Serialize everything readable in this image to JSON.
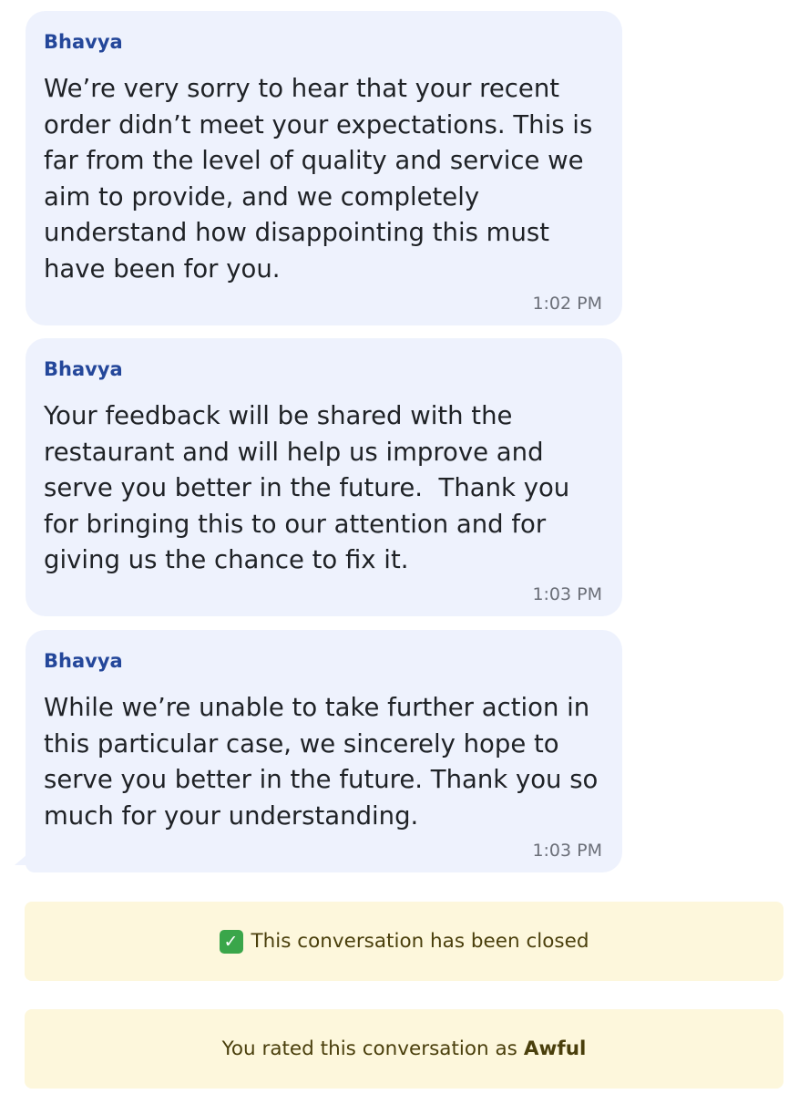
{
  "messages": [
    {
      "sender": "Bhavya",
      "text": "We’re very sorry to hear that your recent order didn’t meet your expectations. This is far from the level of quality and service we aim to provide, and we completely understand how disappointing this must have been for you.",
      "time": "1:02 PM"
    },
    {
      "sender": "Bhavya",
      "text": "Your feedback will be shared with the restaurant and will help us improve and serve you better in the future.  Thank you for bringing this to our attention and for giving us the chance to fix it.",
      "time": "1:03 PM"
    },
    {
      "sender": "Bhavya",
      "text": "While we’re unable to take further action in this particular case, we sincerely hope to serve you better in the future. Thank you so much for your understanding.",
      "time": "1:03 PM"
    }
  ],
  "notices": {
    "closed": {
      "icon": "check-mark-icon",
      "icon_glyph": "✓",
      "text": "This conversation has been closed"
    },
    "rating": {
      "prefix": "You rated this conversation as",
      "value": "Awful"
    }
  },
  "colors": {
    "bubble_bg": "#eef2fd",
    "sender": "#24479a",
    "notice_bg": "#fdf7dc",
    "notice_text": "#4a3f0c",
    "check_green": "#3aa64a"
  }
}
